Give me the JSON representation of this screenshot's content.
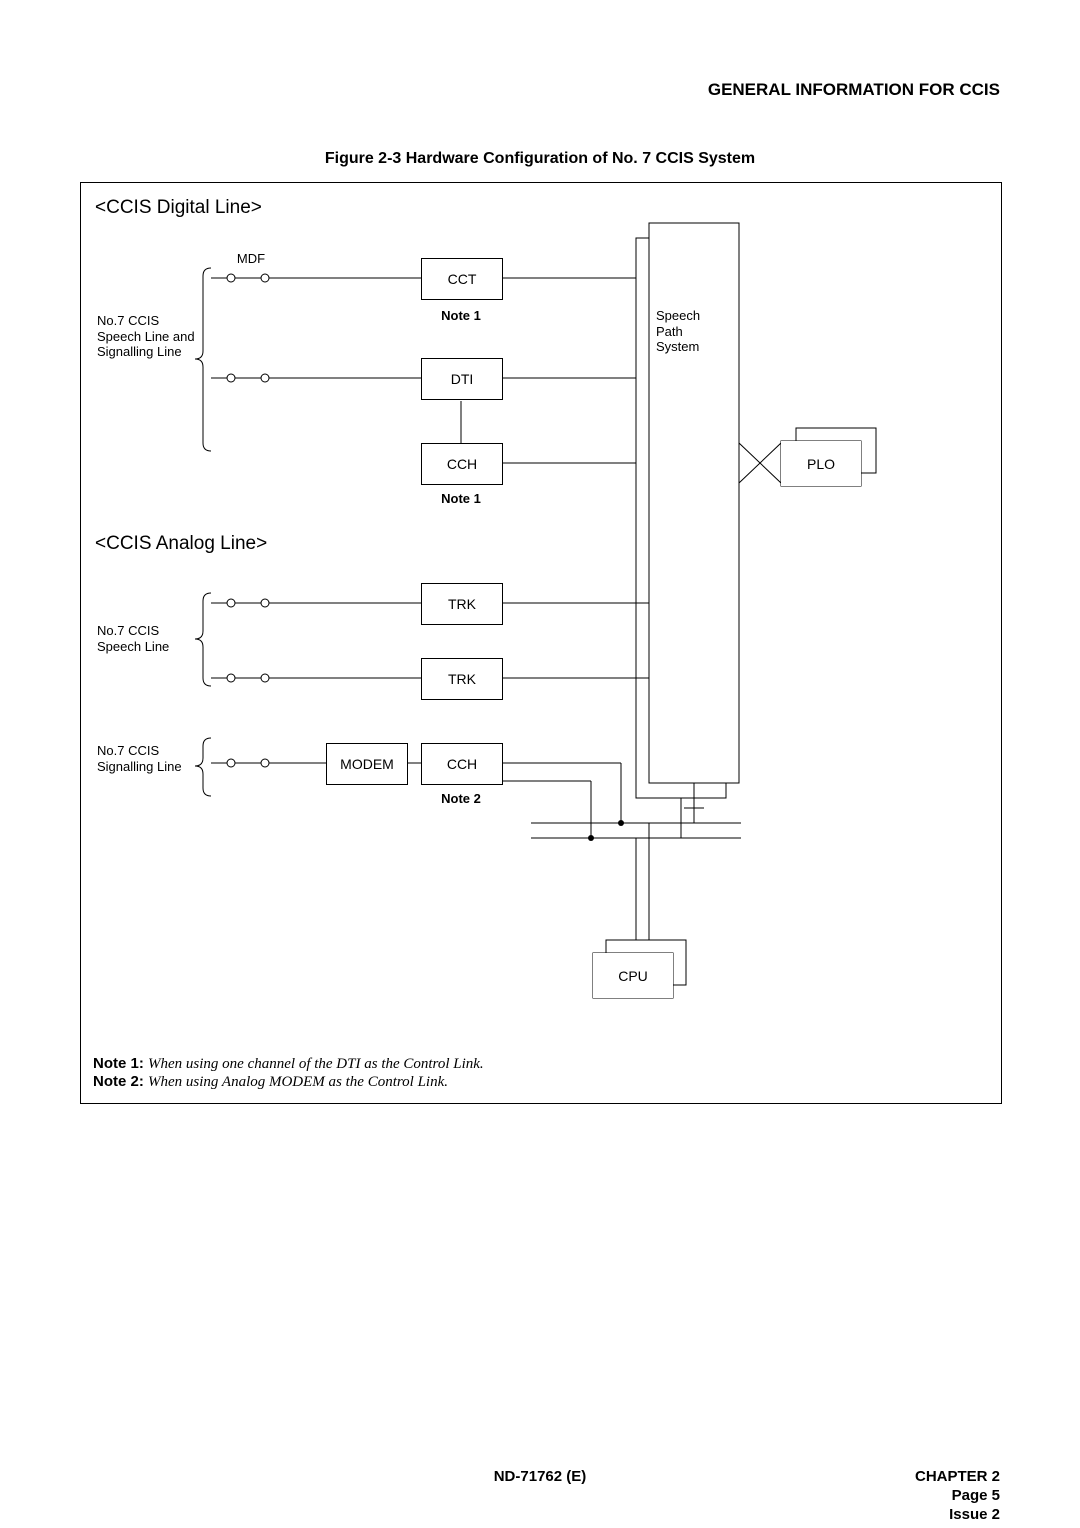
{
  "header": {
    "title": "GENERAL INFORMATION FOR CCIS"
  },
  "figure": {
    "caption": "Figure 2-3   Hardware Configuration of No. 7 CCIS System",
    "sections": {
      "digital": "<CCIS Digital Line>",
      "analog": "<CCIS Analog Line>"
    },
    "labels": {
      "mdf": "MDF",
      "digital_side": "No.7 CCIS Speech Line and Signalling Line",
      "analog_speech": "No.7 CCIS Speech Line",
      "analog_signalling": "No.7 CCIS Signalling Line",
      "speech_path": "Speech Path System"
    },
    "boxes": {
      "cct": "CCT",
      "dti": "DTI",
      "cch1": "CCH",
      "trk1": "TRK",
      "trk2": "TRK",
      "modem": "MODEM",
      "cch2": "CCH",
      "plo": "PLO",
      "cpu": "CPU"
    },
    "notes_inline": {
      "note1a": "Note 1",
      "note1b": "Note 1",
      "note2": "Note 2"
    },
    "footnotes": {
      "n1_label": "Note 1:",
      "n1_text": "When using one channel of the DTI as the Control Link.",
      "n2_label": "Note 2:",
      "n2_text": "When using Analog MODEM as the Control Link."
    }
  },
  "footer": {
    "doc": "ND-71762 (E)",
    "chapter": "CHAPTER 2",
    "page": "Page 5",
    "issue": "Issue 2"
  }
}
